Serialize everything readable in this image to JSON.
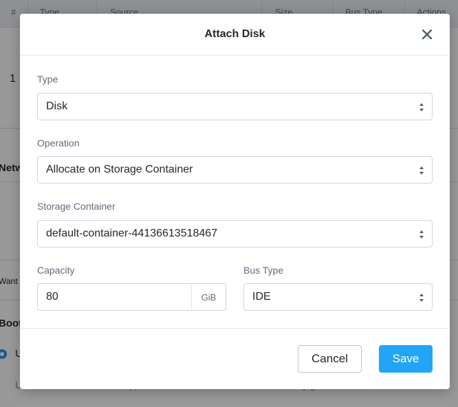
{
  "background": {
    "table_headers": [
      "#",
      "Type",
      "Source",
      "Size",
      "Bus Type",
      "Actions"
    ],
    "row_number": "1",
    "section_network": "Netw",
    "want_label": "Want",
    "boot_label": "Boot",
    "radio_label": "U",
    "footer_left": "U",
    "footer_mid": "pp",
    "footer_right": "y g"
  },
  "modal": {
    "title": "Attach Disk",
    "close_icon": "close-icon",
    "type": {
      "label": "Type",
      "value": "Disk"
    },
    "operation": {
      "label": "Operation",
      "value": "Allocate on Storage Container"
    },
    "storage_container": {
      "label": "Storage Container",
      "value": "default-container-44136613518467"
    },
    "capacity": {
      "label": "Capacity",
      "value": "80",
      "unit": "GiB"
    },
    "bus_type": {
      "label": "Bus Type",
      "value": "IDE"
    },
    "cancel_label": "Cancel",
    "save_label": "Save"
  },
  "colors": {
    "primary": "#22a5f7",
    "overlay": "rgba(0,0,0,0.40)"
  }
}
